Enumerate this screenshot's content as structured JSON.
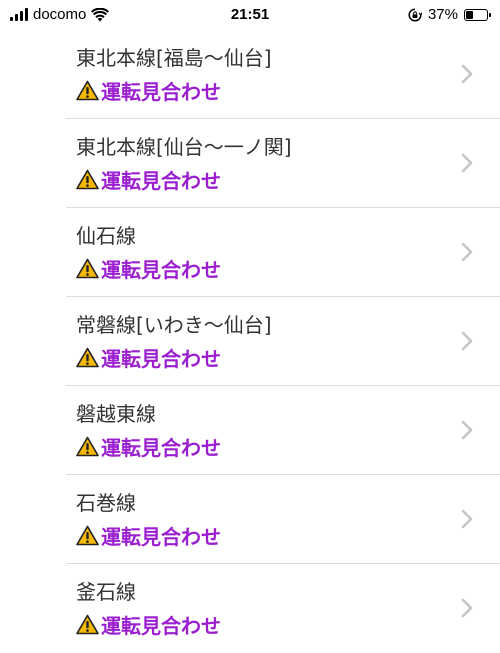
{
  "status_bar": {
    "carrier": "docomo",
    "time": "21:51",
    "battery_percent_label": "37%",
    "battery_level": 0.37,
    "icons": [
      "signal-icon",
      "wifi-icon",
      "rotation-lock-icon",
      "battery-icon"
    ]
  },
  "routes": [
    {
      "name": "東北本線[福島〜仙台]",
      "status": "運転見合わせ"
    },
    {
      "name": "東北本線[仙台〜一ノ関]",
      "status": "運転見合わせ"
    },
    {
      "name": "仙石線",
      "status": "運転見合わせ"
    },
    {
      "name": "常磐線[いわき〜仙台]",
      "status": "運転見合わせ"
    },
    {
      "name": "磐越東線",
      "status": "運転見合わせ"
    },
    {
      "name": "石巻線",
      "status": "運転見合わせ"
    },
    {
      "name": "釜石線",
      "status": "運転見合わせ"
    }
  ],
  "colors": {
    "status_text": "#9b1fd0",
    "warning_fill": "#f5b800",
    "chevron": "#c4c4c9",
    "divider": "#dcdcdc"
  }
}
